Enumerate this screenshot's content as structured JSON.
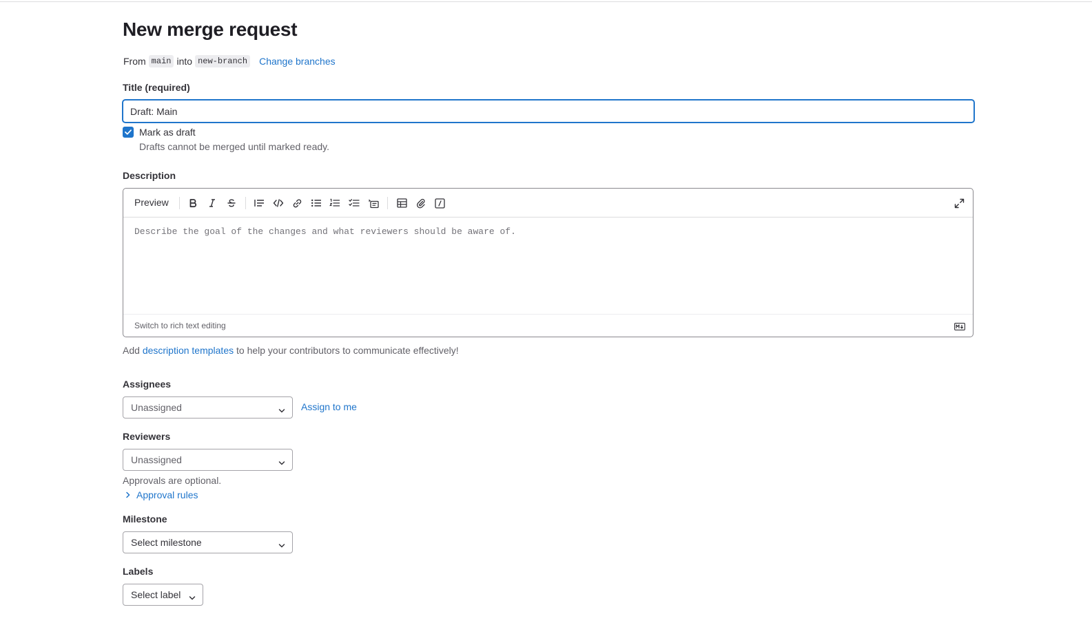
{
  "page": {
    "title": "New merge request"
  },
  "branches": {
    "from_label": "From",
    "source": "main",
    "into_label": "into",
    "target": "new-branch",
    "change_link": "Change branches"
  },
  "title_field": {
    "label": "Title (required)",
    "value": "Draft: Main"
  },
  "draft": {
    "label": "Mark as draft",
    "checked": true,
    "help": "Drafts cannot be merged until marked ready."
  },
  "description": {
    "label": "Description",
    "preview_tab": "Preview",
    "toolbar_icons": [
      "bold-icon",
      "italic-icon",
      "strikethrough-icon",
      "quote-icon",
      "code-icon",
      "link-icon",
      "bulleted-list-icon",
      "numbered-list-icon",
      "task-list-icon",
      "collapsible-section-icon",
      "table-icon",
      "attach-file-icon",
      "quick-actions-icon",
      "fullscreen-icon"
    ],
    "placeholder": "Describe the goal of the changes and what reviewers should be aware of.",
    "rich_text_switch": "Switch to rich text editing",
    "markdown_icon": "markdown-icon"
  },
  "templates_note": {
    "prefix": "Add",
    "link": "description templates",
    "suffix": "to help your contributors to communicate effectively!"
  },
  "assignees": {
    "label": "Assignees",
    "value": "Unassigned",
    "assign_me": "Assign to me"
  },
  "reviewers": {
    "label": "Reviewers",
    "value": "Unassigned",
    "approvals_note": "Approvals are optional.",
    "approval_rules": "Approval rules"
  },
  "milestone": {
    "label": "Milestone",
    "value": "Select milestone"
  },
  "labels": {
    "label": "Labels",
    "value": "Select label"
  },
  "colors": {
    "link": "#1f75cb",
    "focus": "#1f75cb",
    "text": "#333238",
    "muted": "#626168"
  }
}
